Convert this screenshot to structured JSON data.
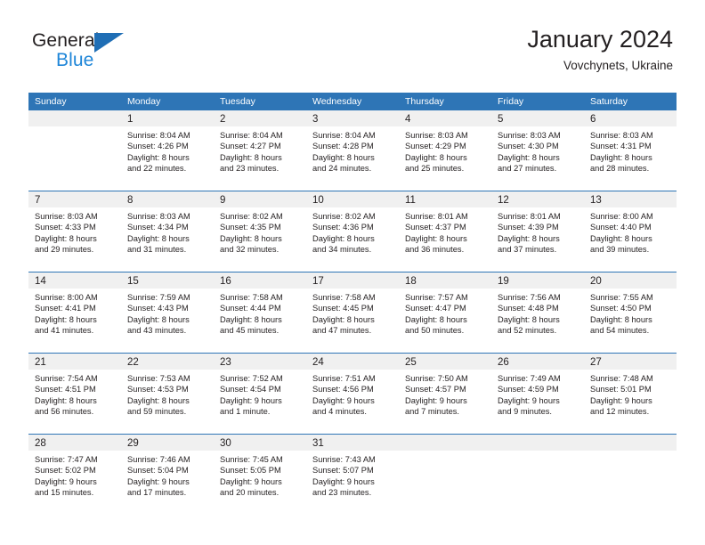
{
  "brand": {
    "name_primary": "General",
    "name_secondary": "Blue",
    "accent_color": "#1f86d8",
    "triangle_color": "#1f6eb5"
  },
  "header": {
    "title": "January 2024",
    "location": "Vovchynets, Ukraine"
  },
  "theme": {
    "header_row_bg": "#2e75b6",
    "header_row_text": "#ffffff",
    "daynum_band_bg": "#f0f0f0",
    "week_separator": "#2e75b6",
    "text_color": "#231f20"
  },
  "calendar": {
    "weekday_headers": [
      "Sunday",
      "Monday",
      "Tuesday",
      "Wednesday",
      "Thursday",
      "Friday",
      "Saturday"
    ],
    "weeks": [
      [
        {
          "day": "",
          "sunrise": "",
          "sunset": "",
          "daylight_line1": "",
          "daylight_line2": "",
          "empty": true
        },
        {
          "day": "1",
          "sunrise": "Sunrise: 8:04 AM",
          "sunset": "Sunset: 4:26 PM",
          "daylight_line1": "Daylight: 8 hours",
          "daylight_line2": "and 22 minutes.",
          "empty": false
        },
        {
          "day": "2",
          "sunrise": "Sunrise: 8:04 AM",
          "sunset": "Sunset: 4:27 PM",
          "daylight_line1": "Daylight: 8 hours",
          "daylight_line2": "and 23 minutes.",
          "empty": false
        },
        {
          "day": "3",
          "sunrise": "Sunrise: 8:04 AM",
          "sunset": "Sunset: 4:28 PM",
          "daylight_line1": "Daylight: 8 hours",
          "daylight_line2": "and 24 minutes.",
          "empty": false
        },
        {
          "day": "4",
          "sunrise": "Sunrise: 8:03 AM",
          "sunset": "Sunset: 4:29 PM",
          "daylight_line1": "Daylight: 8 hours",
          "daylight_line2": "and 25 minutes.",
          "empty": false
        },
        {
          "day": "5",
          "sunrise": "Sunrise: 8:03 AM",
          "sunset": "Sunset: 4:30 PM",
          "daylight_line1": "Daylight: 8 hours",
          "daylight_line2": "and 27 minutes.",
          "empty": false
        },
        {
          "day": "6",
          "sunrise": "Sunrise: 8:03 AM",
          "sunset": "Sunset: 4:31 PM",
          "daylight_line1": "Daylight: 8 hours",
          "daylight_line2": "and 28 minutes.",
          "empty": false
        }
      ],
      [
        {
          "day": "7",
          "sunrise": "Sunrise: 8:03 AM",
          "sunset": "Sunset: 4:33 PM",
          "daylight_line1": "Daylight: 8 hours",
          "daylight_line2": "and 29 minutes.",
          "empty": false
        },
        {
          "day": "8",
          "sunrise": "Sunrise: 8:03 AM",
          "sunset": "Sunset: 4:34 PM",
          "daylight_line1": "Daylight: 8 hours",
          "daylight_line2": "and 31 minutes.",
          "empty": false
        },
        {
          "day": "9",
          "sunrise": "Sunrise: 8:02 AM",
          "sunset": "Sunset: 4:35 PM",
          "daylight_line1": "Daylight: 8 hours",
          "daylight_line2": "and 32 minutes.",
          "empty": false
        },
        {
          "day": "10",
          "sunrise": "Sunrise: 8:02 AM",
          "sunset": "Sunset: 4:36 PM",
          "daylight_line1": "Daylight: 8 hours",
          "daylight_line2": "and 34 minutes.",
          "empty": false
        },
        {
          "day": "11",
          "sunrise": "Sunrise: 8:01 AM",
          "sunset": "Sunset: 4:37 PM",
          "daylight_line1": "Daylight: 8 hours",
          "daylight_line2": "and 36 minutes.",
          "empty": false
        },
        {
          "day": "12",
          "sunrise": "Sunrise: 8:01 AM",
          "sunset": "Sunset: 4:39 PM",
          "daylight_line1": "Daylight: 8 hours",
          "daylight_line2": "and 37 minutes.",
          "empty": false
        },
        {
          "day": "13",
          "sunrise": "Sunrise: 8:00 AM",
          "sunset": "Sunset: 4:40 PM",
          "daylight_line1": "Daylight: 8 hours",
          "daylight_line2": "and 39 minutes.",
          "empty": false
        }
      ],
      [
        {
          "day": "14",
          "sunrise": "Sunrise: 8:00 AM",
          "sunset": "Sunset: 4:41 PM",
          "daylight_line1": "Daylight: 8 hours",
          "daylight_line2": "and 41 minutes.",
          "empty": false
        },
        {
          "day": "15",
          "sunrise": "Sunrise: 7:59 AM",
          "sunset": "Sunset: 4:43 PM",
          "daylight_line1": "Daylight: 8 hours",
          "daylight_line2": "and 43 minutes.",
          "empty": false
        },
        {
          "day": "16",
          "sunrise": "Sunrise: 7:58 AM",
          "sunset": "Sunset: 4:44 PM",
          "daylight_line1": "Daylight: 8 hours",
          "daylight_line2": "and 45 minutes.",
          "empty": false
        },
        {
          "day": "17",
          "sunrise": "Sunrise: 7:58 AM",
          "sunset": "Sunset: 4:45 PM",
          "daylight_line1": "Daylight: 8 hours",
          "daylight_line2": "and 47 minutes.",
          "empty": false
        },
        {
          "day": "18",
          "sunrise": "Sunrise: 7:57 AM",
          "sunset": "Sunset: 4:47 PM",
          "daylight_line1": "Daylight: 8 hours",
          "daylight_line2": "and 50 minutes.",
          "empty": false
        },
        {
          "day": "19",
          "sunrise": "Sunrise: 7:56 AM",
          "sunset": "Sunset: 4:48 PM",
          "daylight_line1": "Daylight: 8 hours",
          "daylight_line2": "and 52 minutes.",
          "empty": false
        },
        {
          "day": "20",
          "sunrise": "Sunrise: 7:55 AM",
          "sunset": "Sunset: 4:50 PM",
          "daylight_line1": "Daylight: 8 hours",
          "daylight_line2": "and 54 minutes.",
          "empty": false
        }
      ],
      [
        {
          "day": "21",
          "sunrise": "Sunrise: 7:54 AM",
          "sunset": "Sunset: 4:51 PM",
          "daylight_line1": "Daylight: 8 hours",
          "daylight_line2": "and 56 minutes.",
          "empty": false
        },
        {
          "day": "22",
          "sunrise": "Sunrise: 7:53 AM",
          "sunset": "Sunset: 4:53 PM",
          "daylight_line1": "Daylight: 8 hours",
          "daylight_line2": "and 59 minutes.",
          "empty": false
        },
        {
          "day": "23",
          "sunrise": "Sunrise: 7:52 AM",
          "sunset": "Sunset: 4:54 PM",
          "daylight_line1": "Daylight: 9 hours",
          "daylight_line2": "and 1 minute.",
          "empty": false
        },
        {
          "day": "24",
          "sunrise": "Sunrise: 7:51 AM",
          "sunset": "Sunset: 4:56 PM",
          "daylight_line1": "Daylight: 9 hours",
          "daylight_line2": "and 4 minutes.",
          "empty": false
        },
        {
          "day": "25",
          "sunrise": "Sunrise: 7:50 AM",
          "sunset": "Sunset: 4:57 PM",
          "daylight_line1": "Daylight: 9 hours",
          "daylight_line2": "and 7 minutes.",
          "empty": false
        },
        {
          "day": "26",
          "sunrise": "Sunrise: 7:49 AM",
          "sunset": "Sunset: 4:59 PM",
          "daylight_line1": "Daylight: 9 hours",
          "daylight_line2": "and 9 minutes.",
          "empty": false
        },
        {
          "day": "27",
          "sunrise": "Sunrise: 7:48 AM",
          "sunset": "Sunset: 5:01 PM",
          "daylight_line1": "Daylight: 9 hours",
          "daylight_line2": "and 12 minutes.",
          "empty": false
        }
      ],
      [
        {
          "day": "28",
          "sunrise": "Sunrise: 7:47 AM",
          "sunset": "Sunset: 5:02 PM",
          "daylight_line1": "Daylight: 9 hours",
          "daylight_line2": "and 15 minutes.",
          "empty": false
        },
        {
          "day": "29",
          "sunrise": "Sunrise: 7:46 AM",
          "sunset": "Sunset: 5:04 PM",
          "daylight_line1": "Daylight: 9 hours",
          "daylight_line2": "and 17 minutes.",
          "empty": false
        },
        {
          "day": "30",
          "sunrise": "Sunrise: 7:45 AM",
          "sunset": "Sunset: 5:05 PM",
          "daylight_line1": "Daylight: 9 hours",
          "daylight_line2": "and 20 minutes.",
          "empty": false
        },
        {
          "day": "31",
          "sunrise": "Sunrise: 7:43 AM",
          "sunset": "Sunset: 5:07 PM",
          "daylight_line1": "Daylight: 9 hours",
          "daylight_line2": "and 23 minutes.",
          "empty": false
        },
        {
          "day": "",
          "sunrise": "",
          "sunset": "",
          "daylight_line1": "",
          "daylight_line2": "",
          "empty": true
        },
        {
          "day": "",
          "sunrise": "",
          "sunset": "",
          "daylight_line1": "",
          "daylight_line2": "",
          "empty": true
        },
        {
          "day": "",
          "sunrise": "",
          "sunset": "",
          "daylight_line1": "",
          "daylight_line2": "",
          "empty": true
        }
      ]
    ]
  }
}
